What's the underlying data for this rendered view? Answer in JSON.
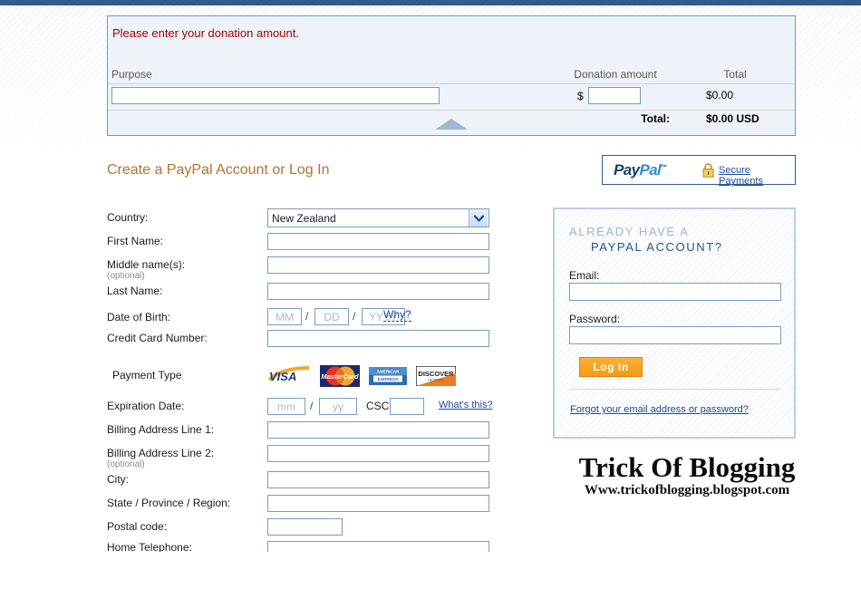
{
  "donation": {
    "alert": "Please enter your donation amount.",
    "columns": {
      "purpose": "Purpose",
      "amount": "Donation amount",
      "total": "Total"
    },
    "purpose_value": "",
    "purpose_placeholder": "",
    "currency_symbol": "$",
    "amount_value": "",
    "amount_placeholder": "",
    "row_total": "$0.00",
    "grand_total_label": "Total:",
    "grand_total_value": "$0.00 USD"
  },
  "section": {
    "title": "Create a PayPal Account or Log In"
  },
  "secure": {
    "logo_pay": "Pay",
    "logo_pal": "Pal",
    "logo_tm": "™",
    "lock_icon": "lock-icon",
    "link": "Secure Payments"
  },
  "form": {
    "labels": {
      "country": "Country:",
      "first_name": "First Name:",
      "middle_name": "Middle name(s):",
      "middle_name_optional": "(optional)",
      "last_name": "Last Name:",
      "dob": "Date of Birth:",
      "credit_card": "Credit Card Number:",
      "payment_type": "Payment Type",
      "expiration": "Expiration Date:",
      "billing1": "Billing Address Line 1:",
      "billing2": "Billing Address Line 2:",
      "billing2_optional": "(optional)",
      "city": "City:",
      "state": "State / Province / Region:",
      "postal": "Postal code:",
      "clipped": "Home Telephone:"
    },
    "country_value": "New Zealand",
    "country_options": [
      "New Zealand"
    ],
    "country_chevron_icon": "chevron-down-icon",
    "first_name_value": "",
    "middle_name_value": "",
    "last_name_value": "",
    "dob": {
      "mm_placeholder": "MM",
      "dd_placeholder": "DD",
      "yyyy_placeholder": "YYYY",
      "separator": "/",
      "why_link": "Why?"
    },
    "credit_card_value": "",
    "expiration": {
      "mm_placeholder": "mm",
      "yy_placeholder": "yy",
      "separator": "/",
      "csc_label": "CSC:",
      "csc_value": "",
      "whats_this_link": "What's this?"
    },
    "billing1_value": "",
    "billing2_value": "",
    "city_value": "",
    "state_value": "",
    "postal_value": "",
    "cards": [
      {
        "name": "visa-logo",
        "label": "VISA"
      },
      {
        "name": "mastercard-logo",
        "label": "MasterCard"
      },
      {
        "name": "amex-logo",
        "label": "AMERICAN EXPRESS"
      },
      {
        "name": "discover-logo",
        "label": "DISCOVER"
      }
    ]
  },
  "login": {
    "title_line1": "ALREADY HAVE A",
    "title_line2": "PAYPAL ACCOUNT?",
    "email_label": "Email:",
    "email_value": "",
    "password_label": "Password:",
    "password_value": "",
    "login_button": "Log In",
    "forgot_link": "Forgot your email address or password?"
  },
  "watermark": {
    "main": "Trick Of Blogging",
    "sub": "Www.trickofblogging.blogspot.com"
  },
  "colors": {
    "accent_blue": "#2e5d8e",
    "alert_red": "#a80000",
    "title_orange": "#b5722a",
    "link_blue": "#1b4b9e",
    "button_orange": "#f59a12",
    "panel_bg": "#eef2f9"
  }
}
